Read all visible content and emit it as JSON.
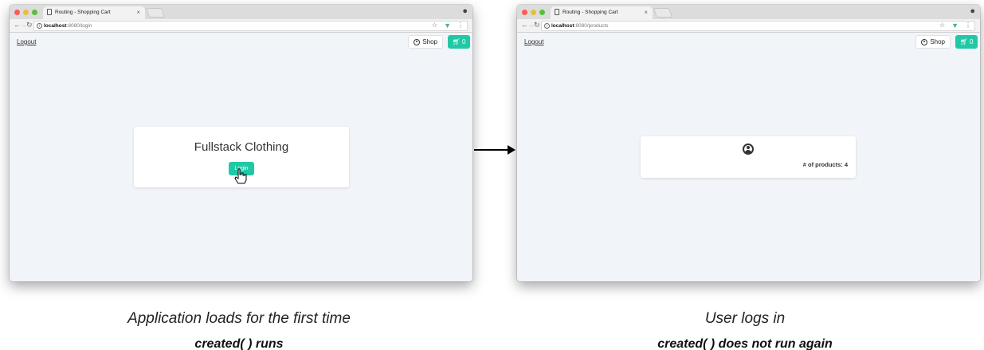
{
  "left_window": {
    "tab_title": "Routing - Shopping Cart",
    "url_host": "localhost",
    "url_path": ":8080/login",
    "logout": "Logout",
    "shop": "Shop",
    "cart_count": "0",
    "heading": "Fullstack Clothing",
    "login_button": "Login"
  },
  "right_window": {
    "tab_title": "Routing - Shopping Cart",
    "url_host": "localhost",
    "url_path": ":8080/products",
    "logout": "Logout",
    "shop": "Shop",
    "cart_count": "0",
    "product_count": "# of products: 4"
  },
  "captions": {
    "left_line1": "Application loads for the first time",
    "left_line2": "created( ) runs",
    "right_line1": "User logs in",
    "right_line2": "created( ) does not run again"
  },
  "colors": {
    "accent": "#20c9a6",
    "page_background": "#f1f4f8"
  }
}
